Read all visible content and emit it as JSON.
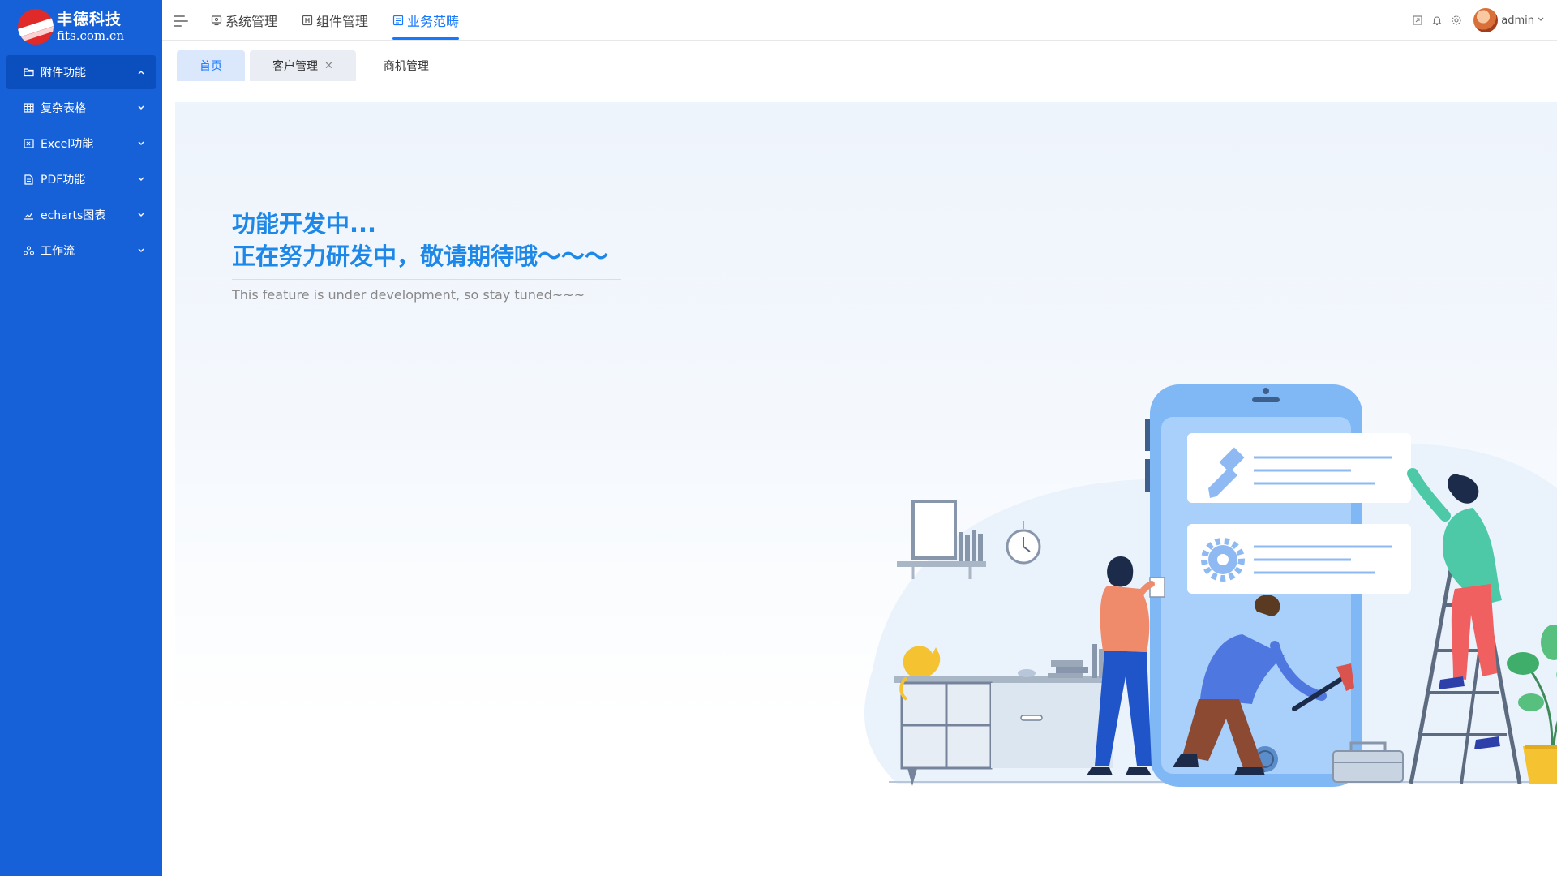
{
  "brand": {
    "name": "丰德科技",
    "domain": "fits.com.cn"
  },
  "sidebar": {
    "items": [
      {
        "label": "附件功能",
        "icon": "folder-icon",
        "arrow": "chevron-up",
        "active": true
      },
      {
        "label": "复杂表格",
        "icon": "table-icon",
        "arrow": "chevron-down",
        "active": false
      },
      {
        "label": "Excel功能",
        "icon": "excel-icon",
        "arrow": "chevron-down",
        "active": false
      },
      {
        "label": "PDF功能",
        "icon": "pdf-icon",
        "arrow": "chevron-down",
        "active": false
      },
      {
        "label": "echarts图表",
        "icon": "chart-icon",
        "arrow": "chevron-down",
        "active": false
      },
      {
        "label": "工作流",
        "icon": "workflow-icon",
        "arrow": "chevron-down",
        "active": false
      }
    ]
  },
  "topnav": {
    "items": [
      {
        "label": "系统管理",
        "icon": "monitor-icon",
        "active": false
      },
      {
        "label": "组件管理",
        "icon": "component-icon",
        "active": false
      },
      {
        "label": "业务范畴",
        "icon": "business-icon",
        "active": true
      }
    ]
  },
  "user": {
    "name": "admin"
  },
  "tabs": [
    {
      "label": "首页",
      "closable": false,
      "active": true
    },
    {
      "label": "客户管理",
      "closable": true,
      "active": false
    },
    {
      "label": "商机管理",
      "closable": false,
      "active": false
    }
  ],
  "main": {
    "headline_1": "功能开发中...",
    "headline_2": "正在努力研发中，敬请期待哦～～～",
    "subline": "This feature is under development, so stay tuned~~~"
  },
  "colors": {
    "sidebar": "#1660d8",
    "accent": "#1677ff",
    "headline": "#1e88e8"
  }
}
